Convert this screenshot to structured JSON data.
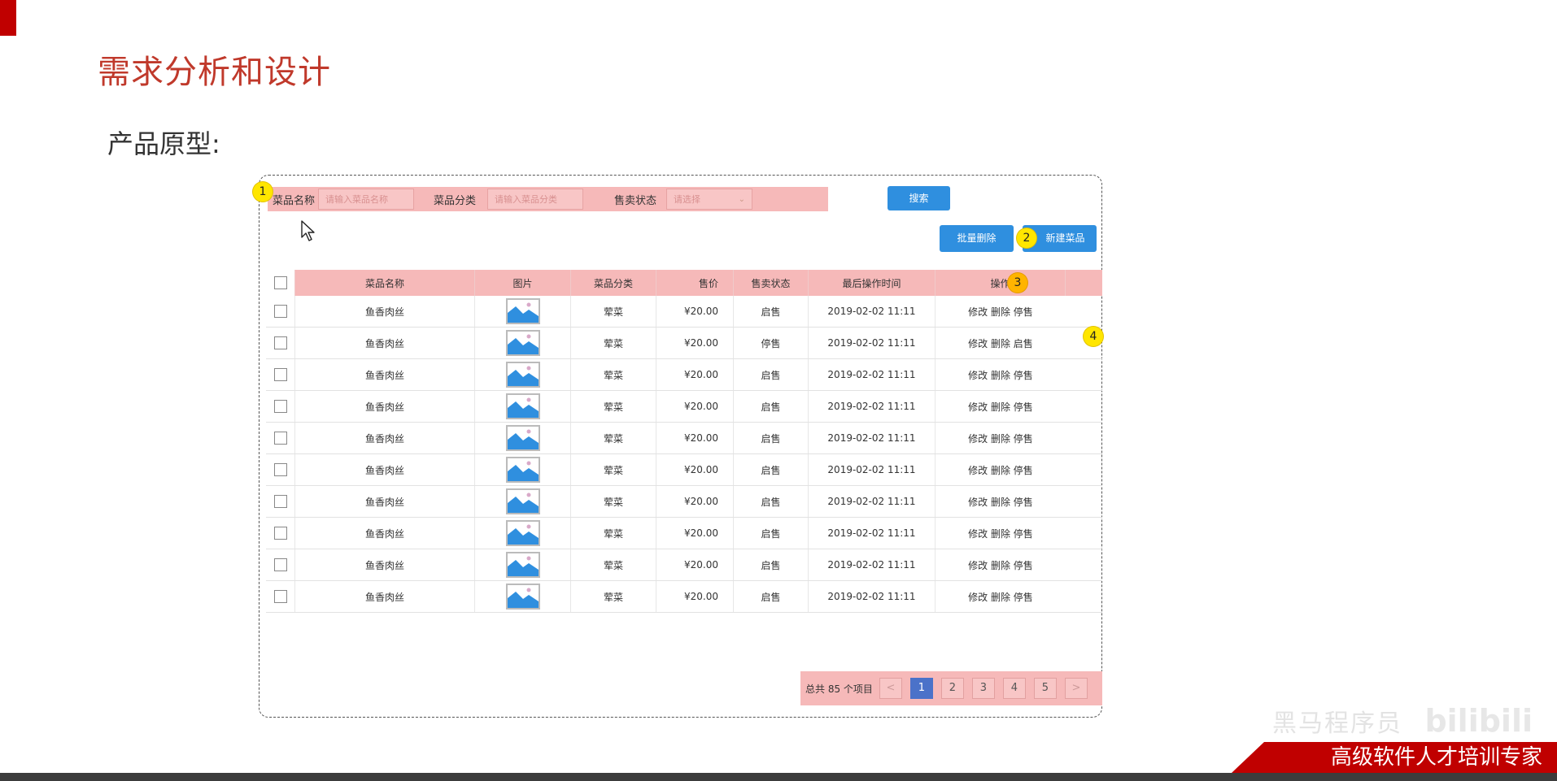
{
  "slide": {
    "title": "需求分析和设计",
    "subtitle": "产品原型:"
  },
  "search": {
    "name_label": "菜品名称",
    "name_placeholder": "请输入菜品名称",
    "category_label": "菜品分类",
    "category_placeholder": "请输入菜品分类",
    "status_label": "售卖状态",
    "status_placeholder": "请选择",
    "search_button": "搜索"
  },
  "actions": {
    "batch_delete": "批量删除",
    "new_dish": "新建菜品"
  },
  "badges": [
    "1",
    "2",
    "3",
    "4"
  ],
  "table": {
    "headers": [
      "菜品名称",
      "图片",
      "菜品分类",
      "售价",
      "售卖状态",
      "最后操作时间",
      "操作"
    ],
    "rows": [
      {
        "name": "鱼香肉丝",
        "category": "荤菜",
        "price": "¥20.00",
        "status": "启售",
        "time": "2019-02-02 11:11",
        "ops": "修改 删除 停售"
      },
      {
        "name": "鱼香肉丝",
        "category": "荤菜",
        "price": "¥20.00",
        "status": "停售",
        "time": "2019-02-02 11:11",
        "ops": "修改 删除 启售"
      },
      {
        "name": "鱼香肉丝",
        "category": "荤菜",
        "price": "¥20.00",
        "status": "启售",
        "time": "2019-02-02 11:11",
        "ops": "修改 删除 停售"
      },
      {
        "name": "鱼香肉丝",
        "category": "荤菜",
        "price": "¥20.00",
        "status": "启售",
        "time": "2019-02-02 11:11",
        "ops": "修改 删除 停售"
      },
      {
        "name": "鱼香肉丝",
        "category": "荤菜",
        "price": "¥20.00",
        "status": "启售",
        "time": "2019-02-02 11:11",
        "ops": "修改 删除 停售"
      },
      {
        "name": "鱼香肉丝",
        "category": "荤菜",
        "price": "¥20.00",
        "status": "启售",
        "time": "2019-02-02 11:11",
        "ops": "修改 删除 停售"
      },
      {
        "name": "鱼香肉丝",
        "category": "荤菜",
        "price": "¥20.00",
        "status": "启售",
        "time": "2019-02-02 11:11",
        "ops": "修改 删除 停售"
      },
      {
        "name": "鱼香肉丝",
        "category": "荤菜",
        "price": "¥20.00",
        "status": "启售",
        "time": "2019-02-02 11:11",
        "ops": "修改 删除 停售"
      },
      {
        "name": "鱼香肉丝",
        "category": "荤菜",
        "price": "¥20.00",
        "status": "启售",
        "time": "2019-02-02 11:11",
        "ops": "修改 删除 停售"
      },
      {
        "name": "鱼香肉丝",
        "category": "荤菜",
        "price": "¥20.00",
        "status": "启售",
        "time": "2019-02-02 11:11",
        "ops": "修改 删除 停售"
      }
    ]
  },
  "pagination": {
    "total": "总共 85 个项目",
    "prev": "<",
    "next": ">",
    "pages": [
      "1",
      "2",
      "3",
      "4",
      "5"
    ],
    "current": "1"
  },
  "footer": {
    "brand": "高级软件人才培训专家",
    "watermark": "黑马程序员",
    "logo": "bilibili"
  },
  "colors": {
    "title_red": "#c0392b",
    "highlight_pink": "#f6b9b9",
    "button_blue": "#2f8fdf",
    "page_active": "#4b72c9",
    "badge_yellow": "#ffe600",
    "brand_red": "#c00000"
  },
  "icons": {
    "row_image": "image-placeholder-icon",
    "cursor": "mouse-pointer-icon",
    "select": "chevron-down-icon"
  }
}
